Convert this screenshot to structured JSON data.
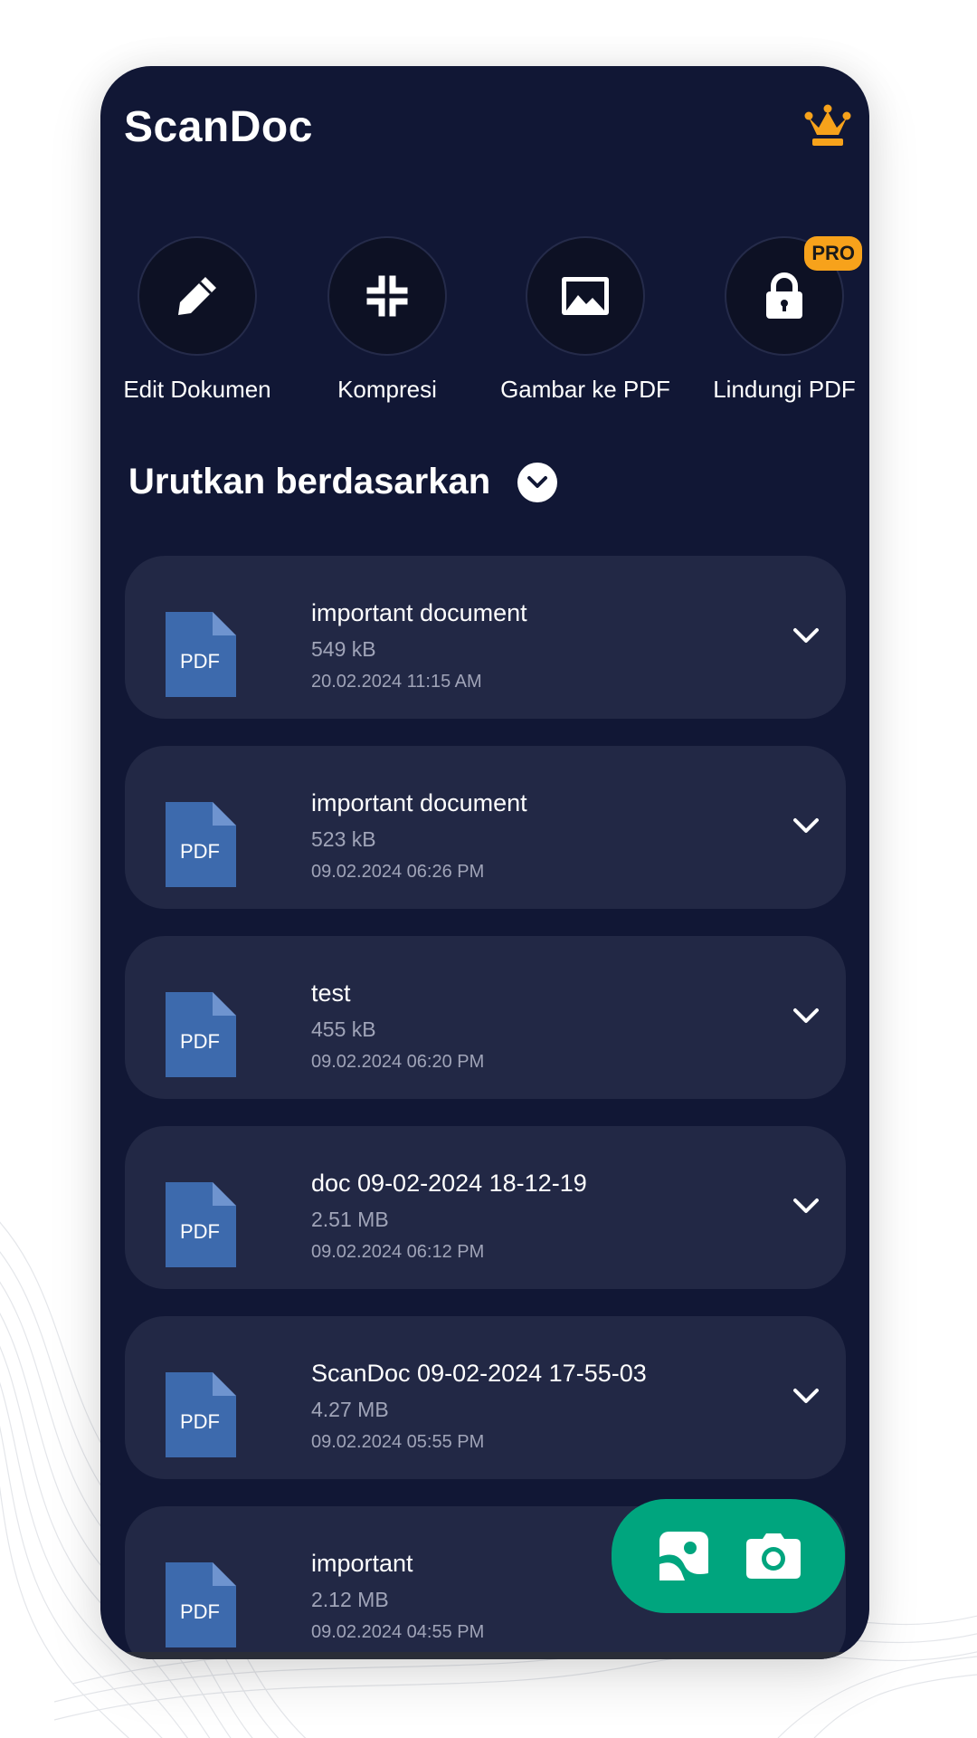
{
  "header": {
    "title": "ScanDoc",
    "premium_icon": "crown-icon",
    "accent_color": "#f7a21b"
  },
  "tools": [
    {
      "label": "Edit Dokumen",
      "icon": "pencil-icon"
    },
    {
      "label": "Kompresi",
      "icon": "compress-icon"
    },
    {
      "label": "Gambar ke PDF",
      "icon": "image-icon"
    },
    {
      "label": "Lindungi PDF",
      "icon": "lock-icon",
      "badge": "PRO"
    }
  ],
  "sort": {
    "label": "Urutkan berdasarkan",
    "icon": "chevron-down-icon"
  },
  "files": [
    {
      "type_label": "PDF",
      "name": "important document",
      "size": "549 kB",
      "date": "20.02.2024 11:15 AM"
    },
    {
      "type_label": "PDF",
      "name": "important document",
      "size": "523 kB",
      "date": "09.02.2024 06:26 PM"
    },
    {
      "type_label": "PDF",
      "name": "test",
      "size": "455 kB",
      "date": "09.02.2024 06:20 PM"
    },
    {
      "type_label": "PDF",
      "name": "doc 09-02-2024 18-12-19",
      "size": "2.51 MB",
      "date": "09.02.2024 06:12 PM"
    },
    {
      "type_label": "PDF",
      "name": "ScanDoc 09-02-2024 17-55-03",
      "size": "4.27 MB",
      "date": "09.02.2024 05:55 PM"
    },
    {
      "type_label": "PDF",
      "name": "important",
      "size": "2.12 MB",
      "date": "09.02.2024 04:55 PM"
    }
  ],
  "fab": {
    "gallery_icon": "gallery-icon",
    "camera_icon": "camera-icon",
    "color": "#00a57e"
  },
  "colors": {
    "background": "#111735",
    "card": "#222845",
    "pdf_icon": "#3d6aad",
    "secondary_text": "#a0a4b8"
  }
}
